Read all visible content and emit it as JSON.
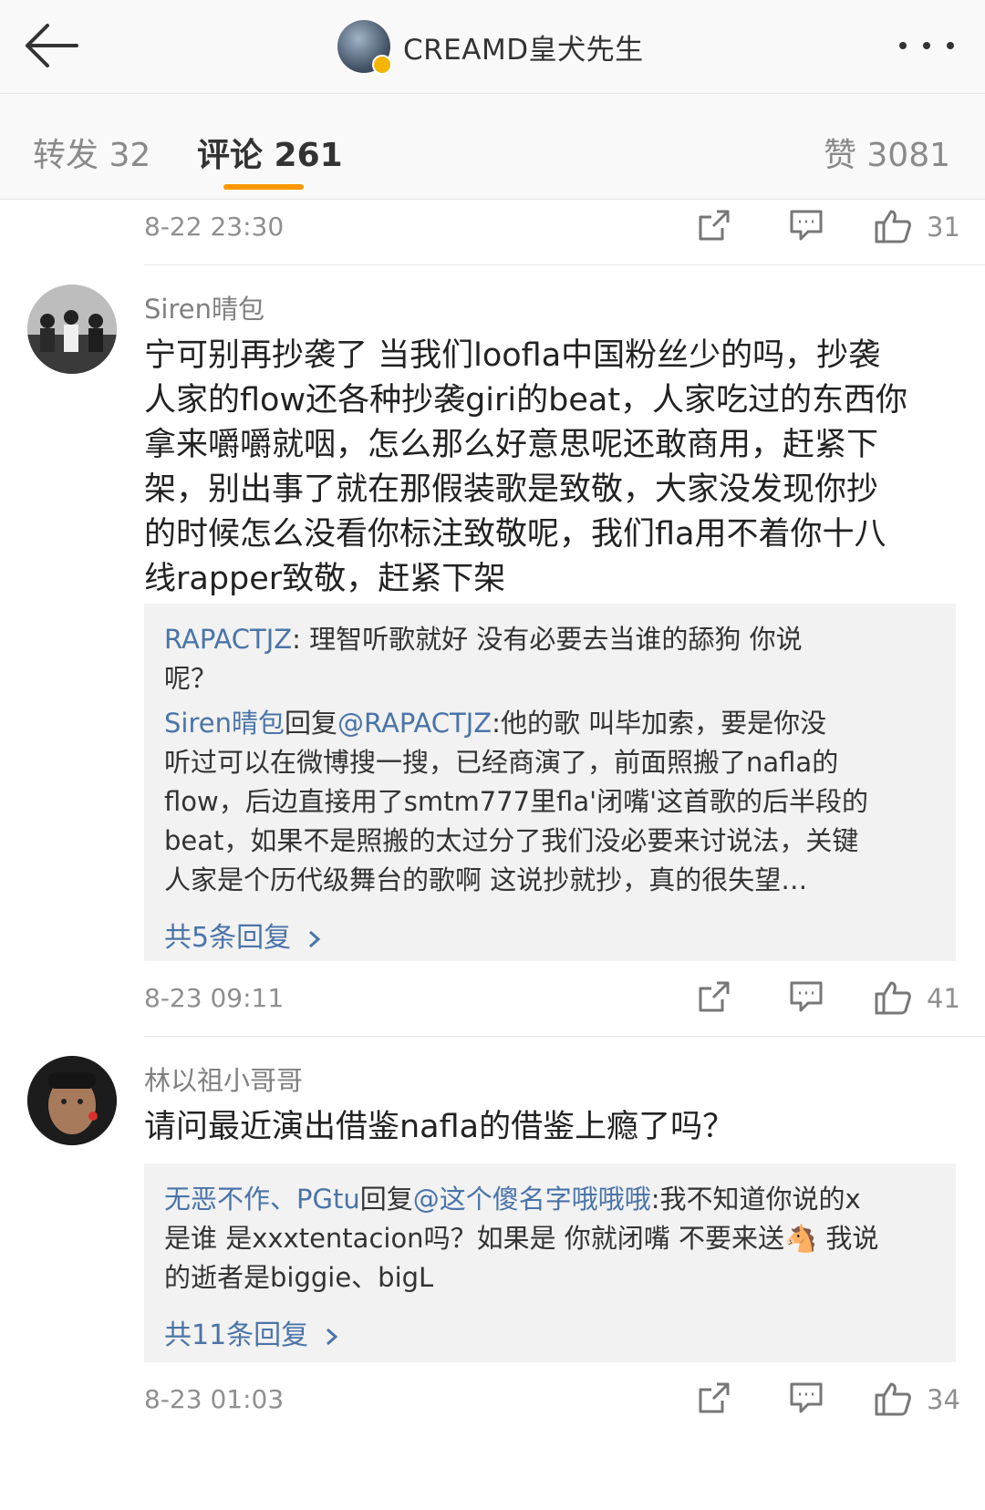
{
  "header": {
    "title": "CREAMD皇犬先生"
  },
  "tabs": {
    "repost_label": "转发 32",
    "comment_label": "评论 261",
    "like_label": "赞 3081"
  },
  "top_meta": {
    "time": "8-22 23:30",
    "likes": "31"
  },
  "comments": [
    {
      "username": "Siren晴包",
      "lines": [
        "宁可别再抄袭了 当我们loofla中国粉丝少的吗，抄袭",
        "人家的flow还各种抄袭giri的beat，人家吃过的东西你",
        "拿来嚼嚼就咽，怎么那么好意思呢还敢商用，赶紧下",
        "架，别出事了就在那假装歌是致敬，大家没发现你抄",
        "的时候怎么没看你标注致敬呢，我们fla用不着你十八",
        "线rapper致敬，赶紧下架"
      ],
      "replies": {
        "r1_name": "RAPACTJZ",
        "r1_line1": ": 理智听歌就好  没有必要去当谁的舔狗  你说",
        "r1_line2": "呢？",
        "r2_name": "Siren晴包",
        "r2_mid": "回复",
        "r2_mention": "@RAPACTJZ",
        "r2_line1": ":他的歌 叫毕加索，要是你没",
        "r2_line2": "听过可以在微博搜一搜，已经商演了，前面照搬了nafla的",
        "r2_line3": "flow，后边直接用了smtm777里fla'闭嘴'这首歌的后半段的",
        "r2_line4": "beat，如果不是照搬的太过分了我们没必要来讨说法，关键",
        "r2_line5": "人家是个历代级舞台的歌啊 这说抄就抄，真的很失望…",
        "more": "共5条回复"
      },
      "time": "8-23 09:11",
      "likes": "41"
    },
    {
      "username": "林以祖小哥哥",
      "lines": [
        "请问最近演出借鉴nafla的借鉴上瘾了吗？"
      ],
      "replies": {
        "r1_name": "无恶不作、PGtu",
        "r1_mid": "回复",
        "r1_mention": "@这个傻名字哦哦哦",
        "r1_line1": ":我不知道你说的x",
        "r1_line2": "是谁 是xxxtentacion吗？如果是 你就闭嘴 不要来送",
        "r1_emoji": "🐴",
        "r1_line2b": " 我说",
        "r1_line3": "的逝者是biggie、bigL",
        "more": "共11条回复"
      },
      "time": "8-23 01:03",
      "likes": "34"
    }
  ],
  "icons": [
    "back-arrow-icon",
    "more-dots-icon",
    "share-icon",
    "comment-icon",
    "thumbs-up-icon",
    "chevron-right-icon"
  ],
  "colors": {
    "accent": "#ff9800",
    "link": "#4a74a8",
    "reply_bg": "#f2f2f2"
  }
}
